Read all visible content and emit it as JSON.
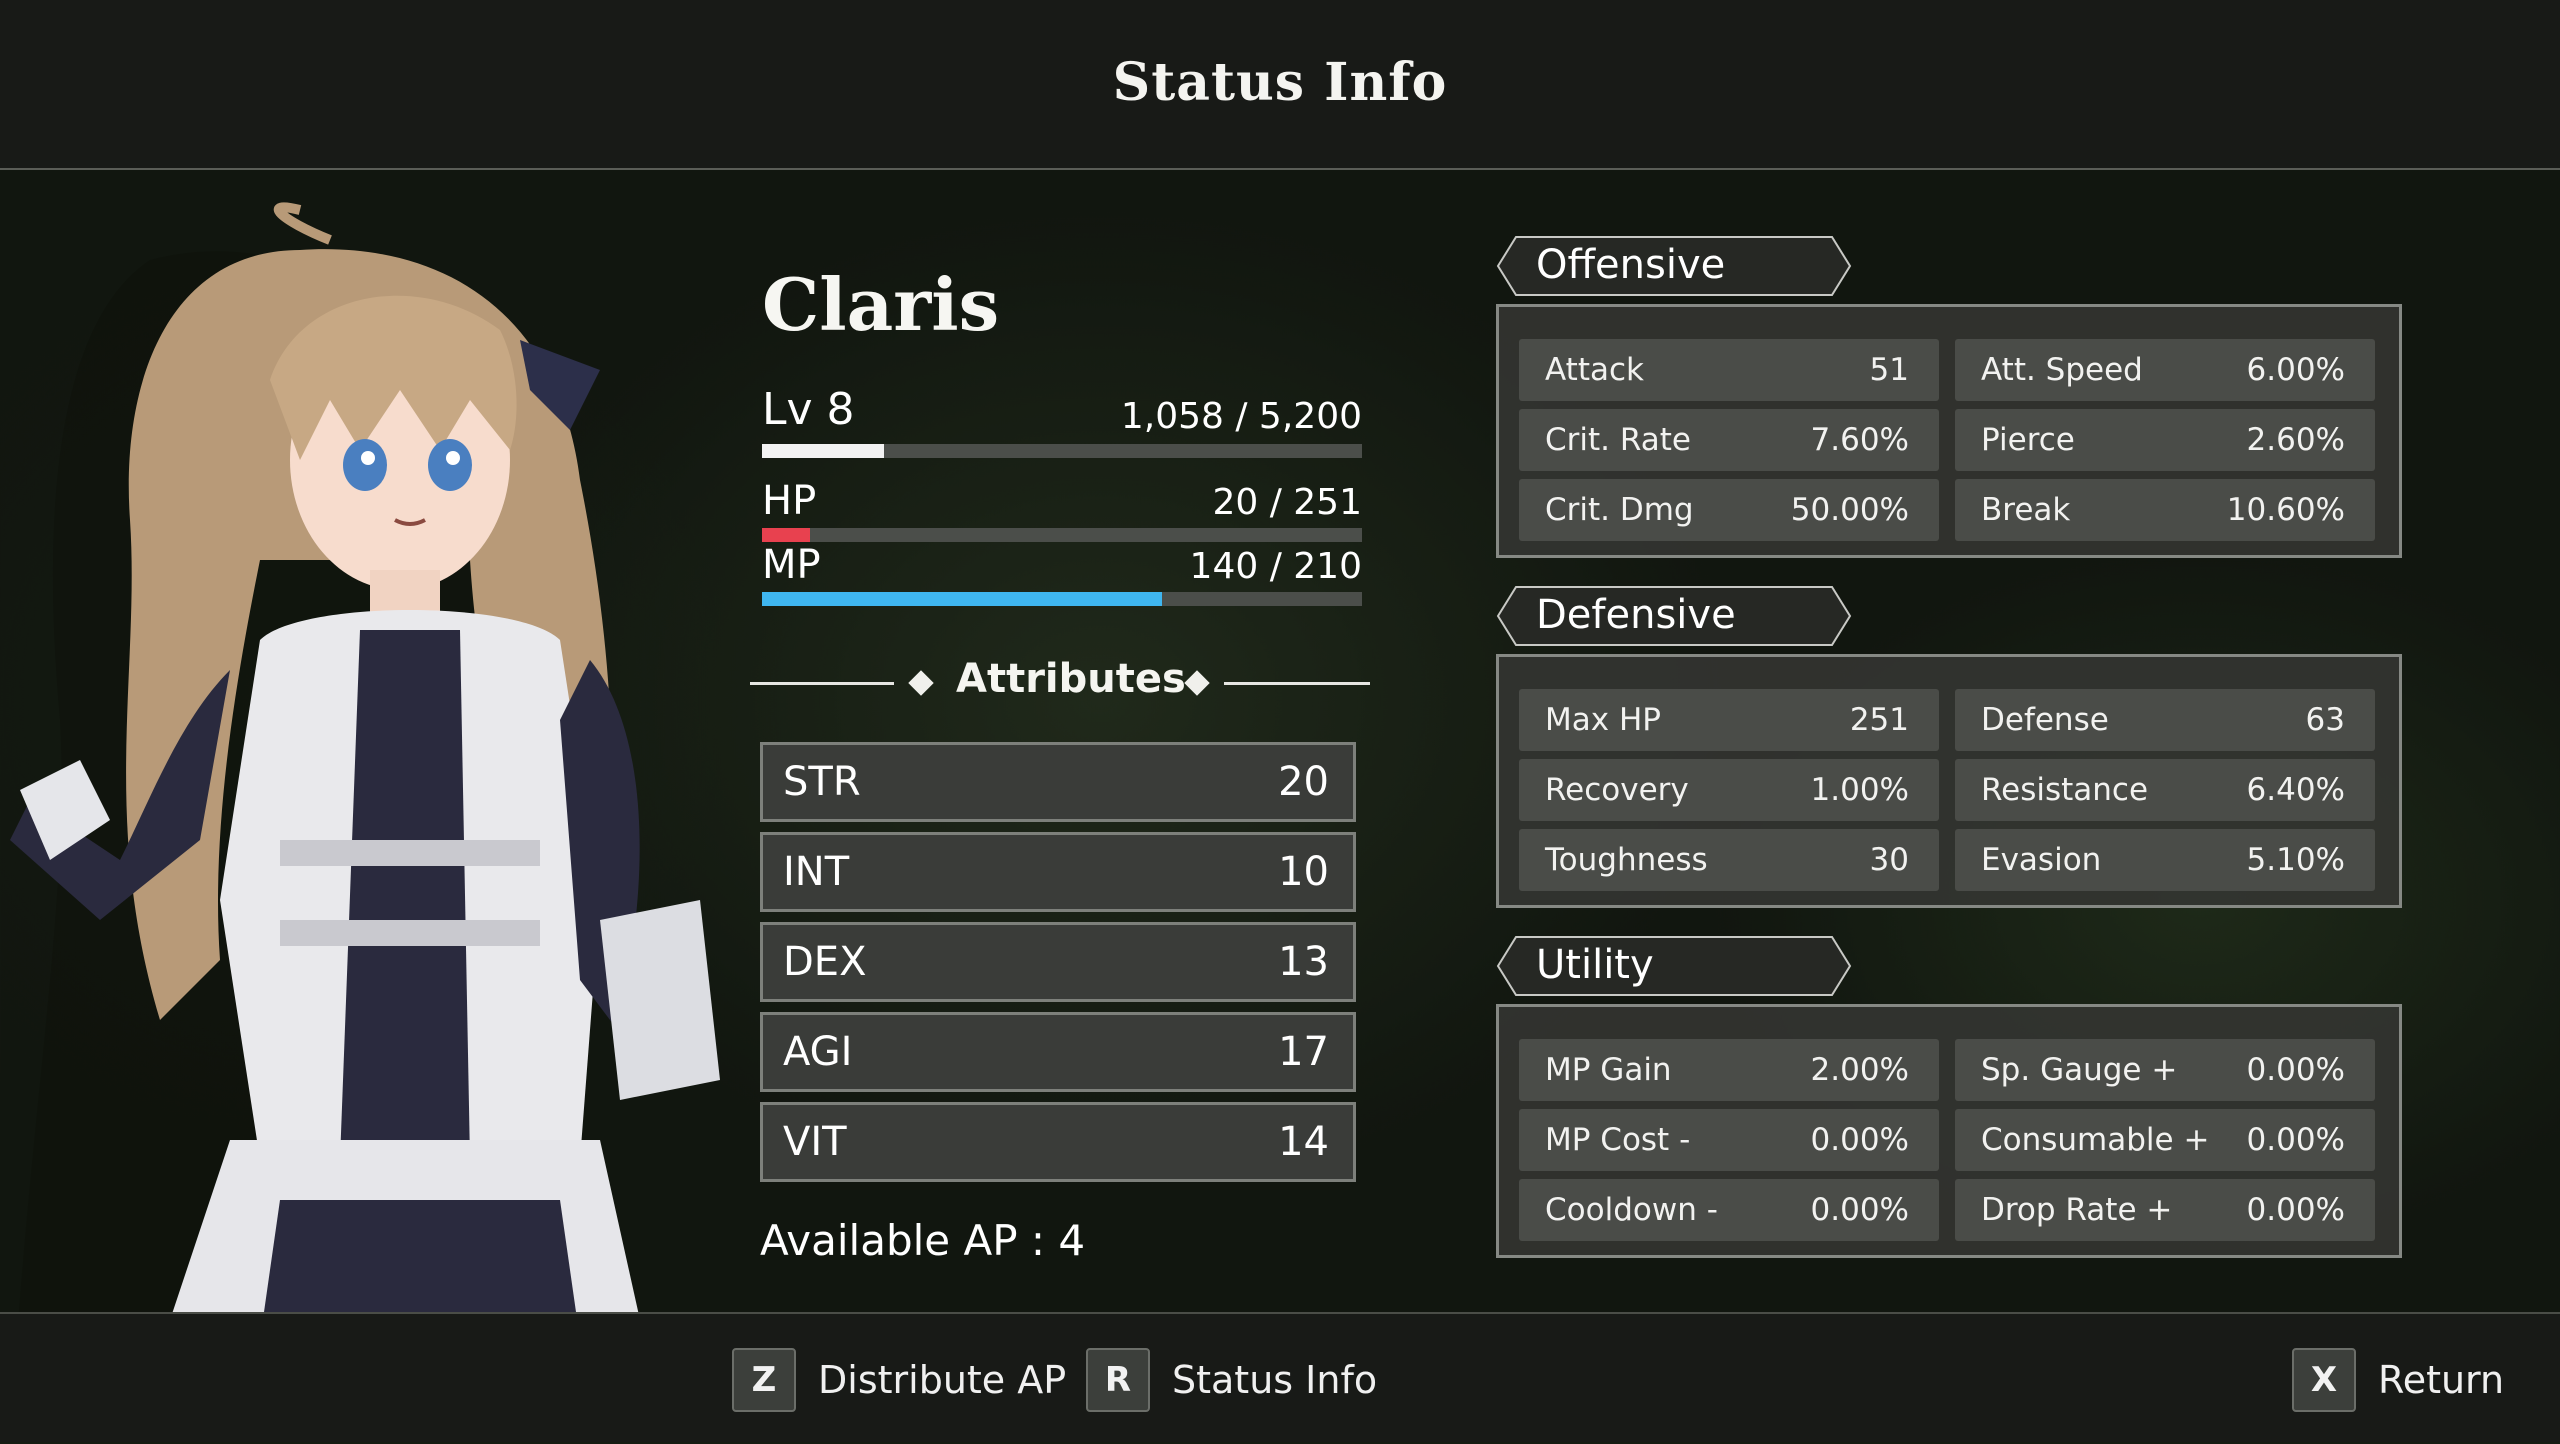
{
  "header": {
    "title": "Status Info"
  },
  "character": {
    "name": "Claris",
    "level_label": "Lv 8",
    "exp_text": "1,058 / 5,200",
    "exp_fraction": 0.2035,
    "hp_label": "HP",
    "hp_text": "20 / 251",
    "hp_fraction": 0.0797,
    "mp_label": "MP",
    "mp_text": "140 / 210",
    "mp_fraction": 0.6667
  },
  "attributes": {
    "title": "Attributes",
    "items": [
      {
        "label": "STR",
        "value": "20"
      },
      {
        "label": "INT",
        "value": "10"
      },
      {
        "label": "DEX",
        "value": "13"
      },
      {
        "label": "AGI",
        "value": "17"
      },
      {
        "label": "VIT",
        "value": "14"
      }
    ],
    "available_ap": "Available AP : 4"
  },
  "sections": [
    {
      "title": "Offensive",
      "stats": [
        {
          "label": "Attack",
          "value": "51"
        },
        {
          "label": "Att. Speed",
          "value": "6.00%"
        },
        {
          "label": "Crit. Rate",
          "value": "7.60%"
        },
        {
          "label": "Pierce",
          "value": "2.60%"
        },
        {
          "label": "Crit. Dmg",
          "value": "50.00%"
        },
        {
          "label": "Break",
          "value": "10.60%"
        }
      ]
    },
    {
      "title": "Defensive",
      "stats": [
        {
          "label": "Max HP",
          "value": "251"
        },
        {
          "label": "Defense",
          "value": "63"
        },
        {
          "label": "Recovery",
          "value": "1.00%"
        },
        {
          "label": "Resistance",
          "value": "6.40%"
        },
        {
          "label": "Toughness",
          "value": "30"
        },
        {
          "label": "Evasion",
          "value": "5.10%"
        }
      ]
    },
    {
      "title": "Utility",
      "stats": [
        {
          "label": "MP Gain",
          "value": "2.00%"
        },
        {
          "label": "Sp. Gauge +",
          "value": "0.00%"
        },
        {
          "label": "MP Cost -",
          "value": "0.00%"
        },
        {
          "label": "Consumable +",
          "value": "0.00%"
        },
        {
          "label": "Cooldown -",
          "value": "0.00%"
        },
        {
          "label": "Drop Rate +",
          "value": "0.00%"
        }
      ]
    }
  ],
  "footer": {
    "distribute": {
      "key": "Z",
      "label": "Distribute AP"
    },
    "status": {
      "key": "R",
      "label": "Status Info"
    },
    "return": {
      "key": "X",
      "label": "Return"
    }
  },
  "colors": {
    "exp_bar": "#f2f2f2",
    "hp_bar": "#e8414f",
    "mp_bar": "#3fb6f0",
    "bar_track": "#4b4e4a"
  }
}
